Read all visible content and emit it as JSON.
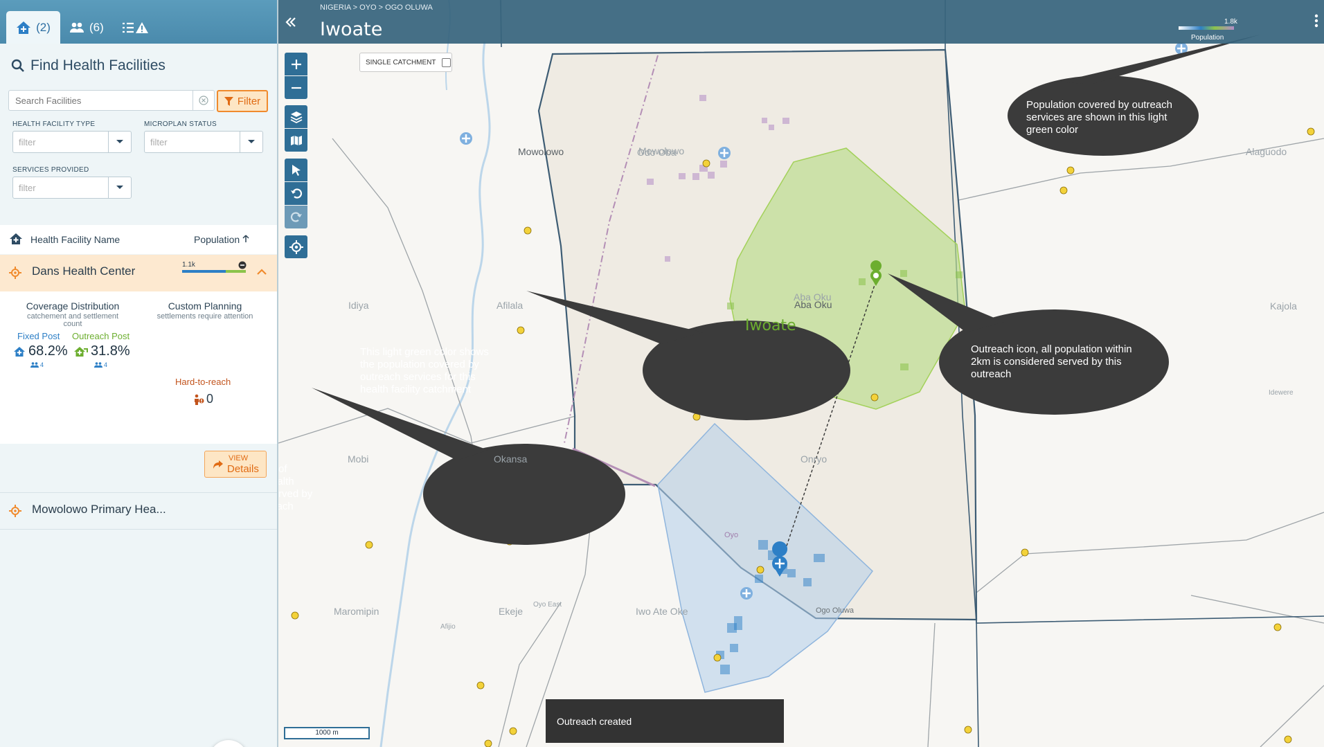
{
  "sidebar": {
    "tabs": [
      {
        "label": "(2)",
        "icon": "facility-home-icon"
      },
      {
        "label": "(6)",
        "icon": "people-icon"
      },
      {
        "label": "",
        "icon": "checklist-warning-icon"
      }
    ],
    "find_title": "Find Health Facilities",
    "search_placeholder": "Search Facilities",
    "filter_label": "Filter",
    "filters": [
      {
        "label": "HEALTH FACILITY TYPE",
        "placeholder": "filter"
      },
      {
        "label": "MICROPLAN STATUS",
        "placeholder": "filter"
      },
      {
        "label": "SERVICES PROVIDED",
        "placeholder": "filter"
      }
    ],
    "list_header": {
      "name": "Health Facility Name",
      "population": "Population"
    },
    "facilities": [
      {
        "name": "Dans Health Center",
        "population": "1.1k",
        "coverage": {
          "title": "Coverage Distribution",
          "subtitle": "catchement and settlement count",
          "fixed_label": "Fixed Post",
          "outreach_label": "Outreach Post",
          "fixed_pct": "68.2%",
          "outreach_pct": "31.8%",
          "fixed_settlements": "4",
          "outreach_settlements": "4"
        },
        "planning": {
          "title": "Custom Planning",
          "subtitle": "settlements require attention",
          "htr_label": "Hard-to-reach",
          "htr_count": "0"
        },
        "view_line1": "VIEW",
        "view_line2": "Details"
      },
      {
        "name": "Mowolowo Primary Hea..."
      }
    ]
  },
  "map": {
    "breadcrumb": "NIGERIA  >  OYO  >  OGO OLUWA",
    "title": "Iwoate",
    "single_catchment": "SINGLE CATCHMENT",
    "legend_value": "1.8k",
    "legend_label": "Population",
    "scale": "1000 m",
    "toast": "Outreach created",
    "area_label": "Iwoate",
    "towns": [
      {
        "name": "Mowolowo"
      },
      {
        "name": "Odo Oba"
      },
      {
        "name": "Aba Oku"
      },
      {
        "name": "Idiya"
      },
      {
        "name": "Afilala"
      },
      {
        "name": "Alaguodo"
      },
      {
        "name": "Kajola"
      },
      {
        "name": "Mobi"
      },
      {
        "name": "Okansa"
      },
      {
        "name": "Onryo"
      },
      {
        "name": "Maromipin"
      },
      {
        "name": "Ekeje"
      },
      {
        "name": "Iwo Ate Oke"
      },
      {
        "name": "Ogo Oluwa"
      },
      {
        "name": "Oyo"
      },
      {
        "name": "Oyo East"
      },
      {
        "name": "Afijio"
      },
      {
        "name": "Idewere"
      }
    ],
    "colors": {
      "outreach": "#a3d15a",
      "fixed": "#9bbbe0",
      "header": "#37647d",
      "accent": "#f08a2c"
    }
  },
  "annotations": [
    "Population covered by outreach services are shown in this light green color",
    "This light green color shows the population covered by outreach services for this health facility catchment",
    "Outreach icon, all population within 2km is considered served by this outreach",
    "This shows the split of population in this health facility catchment served by fixed-post and outreach services"
  ]
}
